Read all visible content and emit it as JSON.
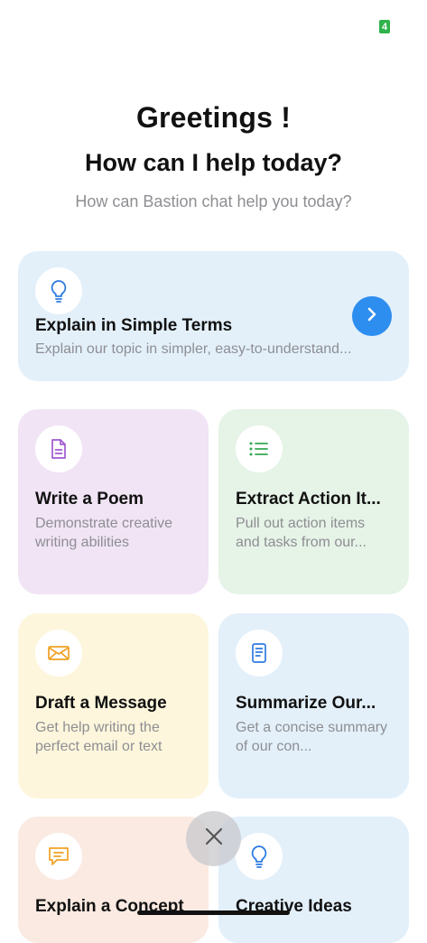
{
  "status": {
    "badge_text": "4",
    "badge_color": "#2fb34a"
  },
  "header": {
    "greeting": "Greetings !",
    "headline": "How can I help today?",
    "subtitle": "How can Bastion chat help you today?"
  },
  "featured": {
    "title": "Explain in Simple Terms",
    "description": "Explain our topic in simpler, easy-to-understand...",
    "icon": "lightbulb-icon",
    "action_icon": "chevron-right-icon",
    "accent_color": "#2d8ef0"
  },
  "cards": [
    {
      "title": "Write a Poem",
      "description": "Demonstrate creative writing abilities",
      "icon": "document-icon",
      "icon_color": "#a05ad0",
      "bg": "#f1e4f5"
    },
    {
      "title": "Extract Action It...",
      "description": "Pull out action items and tasks from our...",
      "icon": "list-icon",
      "icon_color": "#34a853",
      "bg": "#e6f3e7"
    },
    {
      "title": "Draft a Message",
      "description": "Get help writing the perfect email or text",
      "icon": "envelope-icon",
      "icon_color": "#f0a020",
      "bg": "#fdf6dc"
    },
    {
      "title": "Summarize Our...",
      "description": "Get a concise summary of our con...",
      "icon": "summary-document-icon",
      "icon_color": "#2d7be0",
      "bg": "#e3f0fa"
    },
    {
      "title": "Explain a Concept",
      "description": "",
      "icon": "chat-bubble-icon",
      "icon_color": "#f0a020",
      "bg": "#fbeae2"
    },
    {
      "title": "Creative Ideas",
      "description": "",
      "icon": "lightbulb-icon",
      "icon_color": "#2d7be0",
      "bg": "#e3f0fa"
    }
  ],
  "overlay": {
    "close_icon": "close-icon"
  }
}
